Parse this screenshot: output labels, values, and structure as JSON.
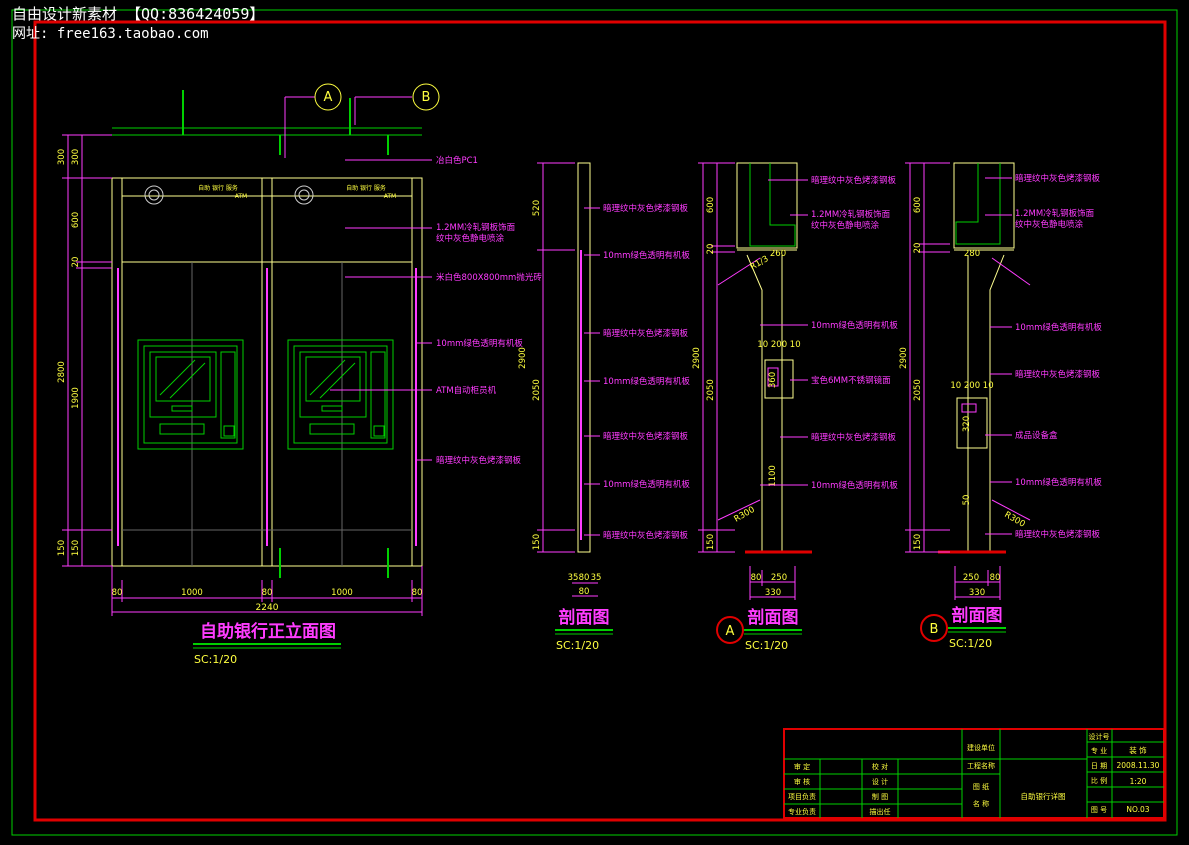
{
  "watermark": {
    "line1": "自由设计新素材   【QQ:836424059】",
    "line2": "网址: free163.taobao.com"
  },
  "colors": {
    "background": "#000000",
    "frame": "#e00000",
    "outline": "#00d000",
    "annotation": "#ff3cff",
    "dimension": "#ffff40",
    "edge": "#ffff90"
  },
  "front_elevation": {
    "title": "自助银行正立面图",
    "scale": "SC:1/20",
    "sign_text": "自助 银行 服务",
    "sign_sub": "ATM",
    "callouts": [
      "A",
      "B"
    ],
    "labels": [
      "冶白色PC1",
      "1.2MM冷轧钢板饰面",
      "纹中灰色静电喷涂",
      "米白色800X800mm抛光砖",
      "10mm绿色透明有机板",
      "ATM自动柜员机",
      "暗理纹中灰色烤漆钢板"
    ],
    "dims_left": [
      "300",
      "300",
      "600",
      "20",
      "2800",
      "1900",
      "150",
      "150"
    ],
    "dims_bottom": [
      "80",
      "1000",
      "80",
      "1000",
      "80"
    ],
    "dim_total": "2240"
  },
  "section_1": {
    "title": "剖面图",
    "scale": "SC:1/20",
    "dims_left": [
      "520",
      "2900",
      "2050",
      "150"
    ],
    "dims_bottom": [
      "35",
      "80",
      "35",
      "80"
    ],
    "labels": [
      "暗理纹中灰色烤漆钢板",
      "10mm绿色透明有机板",
      "暗理纹中灰色烤漆钢板",
      "10mm绿色透明有机板",
      "暗理纹中灰色烤漆钢板",
      "10mm绿色透明有机板",
      "暗理纹中灰色烤漆钢板"
    ]
  },
  "section_A": {
    "badge": "A",
    "title": "剖面图",
    "scale": "SC:1/20",
    "dims_left": [
      "600",
      "20",
      "2900",
      "2050",
      "150"
    ],
    "dims_inner": [
      "260",
      "10 200 10",
      "360",
      "1100",
      "R300",
      "R1/3"
    ],
    "dims_bottom": [
      "80",
      "250",
      "330"
    ],
    "labels": [
      "暗理纹中灰色烤漆钢板",
      "1.2MM冷轧钢板饰面",
      "纹中灰色静电喷涂",
      "10mm绿色透明有机板",
      "宝色6MM不锈钢镜面",
      "暗理纹中灰色烤漆钢板",
      "10mm绿色透明有机板"
    ]
  },
  "section_B": {
    "badge": "B",
    "title": "剖面图",
    "scale": "SC:1/20",
    "dims_left": [
      "600",
      "20",
      "2900",
      "2050",
      "150"
    ],
    "dims_inner": [
      "280",
      "10 200 10",
      "320",
      "50",
      "R300"
    ],
    "dims_bottom": [
      "250",
      "80",
      "330"
    ],
    "labels": [
      "暗理纹中灰色烤漆钢板",
      "1.2MM冷轧钢板饰面",
      "纹中灰色静电喷涂",
      "10mm绿色透明有机板",
      "暗理纹中灰色烤漆钢板",
      "成品设备盒",
      "10mm绿色透明有机板",
      "暗理纹中灰色烤漆钢板"
    ]
  },
  "title_block": {
    "left_labels": [
      "审 定",
      "审 核",
      "项目负责",
      "专业负责"
    ],
    "mid_labels": [
      "校 对",
      "设 计",
      "制 图",
      "描出任"
    ],
    "project_label": "建设单位",
    "project_name_label": "工程名称",
    "drawing_label": "图 纸",
    "drawing_label2": "名 称",
    "drawing_name": "自助银行详图",
    "right_labels": [
      "设计号",
      "专 业",
      "日 期",
      "比 例",
      "图 号"
    ],
    "right_values": [
      "",
      "装 饰",
      "2008.11.30",
      "1:20",
      "NO.03"
    ]
  }
}
